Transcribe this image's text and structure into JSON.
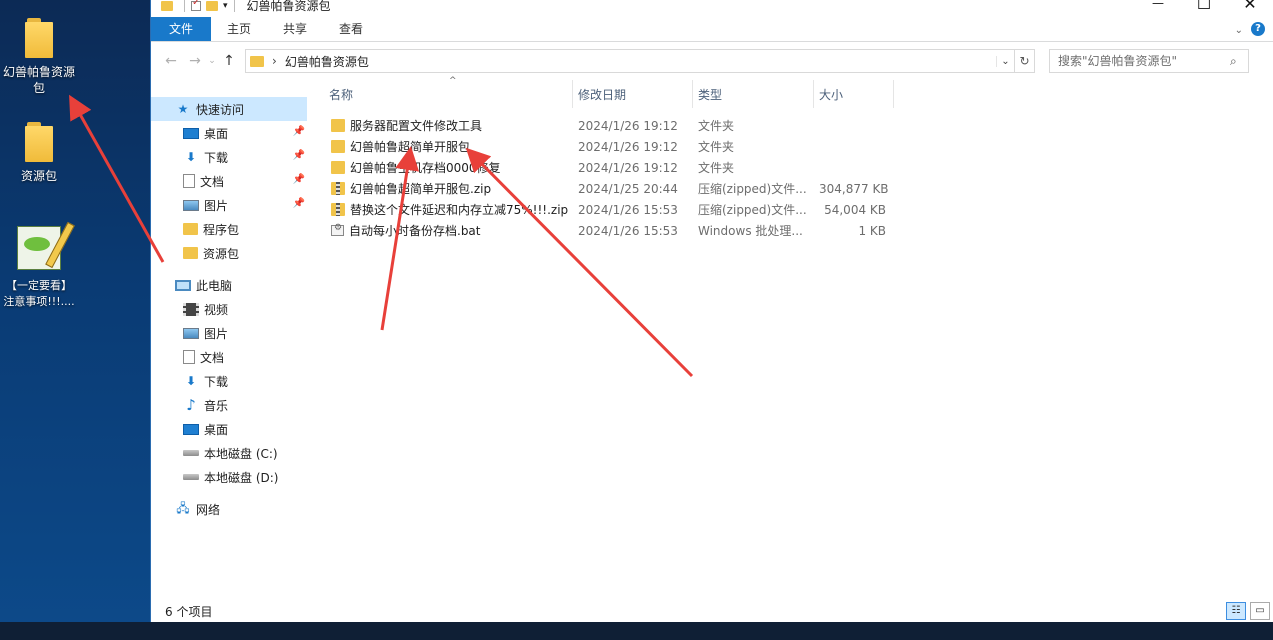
{
  "desktop": {
    "icons": [
      {
        "label": "幻兽帕鲁资源包",
        "type": "folder"
      },
      {
        "label": "资源包",
        "type": "folder"
      },
      {
        "label": "【一定要看】注意事项!!!....",
        "type": "notepad"
      }
    ]
  },
  "window": {
    "title": "幻兽帕鲁资源包",
    "controls": {
      "minimize": "—",
      "maximize": "☐",
      "close": "✕"
    }
  },
  "ribbon": {
    "tabs": [
      "文件",
      "主页",
      "共享",
      "查看"
    ]
  },
  "address": {
    "path": "幻兽帕鲁资源包",
    "search_placeholder": "搜索\"幻兽帕鲁资源包\""
  },
  "nav": {
    "quick_access": "快速访问",
    "items": [
      {
        "label": "桌面",
        "icon": "desktop-icon",
        "pinned": true
      },
      {
        "label": "下载",
        "icon": "download-icon",
        "pinned": true
      },
      {
        "label": "文档",
        "icon": "document-icon",
        "pinned": true
      },
      {
        "label": "图片",
        "icon": "picture-icon",
        "pinned": true
      },
      {
        "label": "程序包",
        "icon": "folder-icon",
        "pinned": false
      },
      {
        "label": "资源包",
        "icon": "folder-icon",
        "pinned": false
      }
    ],
    "this_pc": "此电脑",
    "pc_items": [
      {
        "label": "视频",
        "icon": "video-icon"
      },
      {
        "label": "图片",
        "icon": "picture-icon"
      },
      {
        "label": "文档",
        "icon": "document-icon"
      },
      {
        "label": "下载",
        "icon": "download-icon"
      },
      {
        "label": "音乐",
        "icon": "music-icon"
      },
      {
        "label": "桌面",
        "icon": "desktop-icon"
      },
      {
        "label": "本地磁盘 (C:)",
        "icon": "drive-icon"
      },
      {
        "label": "本地磁盘 (D:)",
        "icon": "drive-icon"
      }
    ],
    "network": "网络"
  },
  "files": {
    "columns": [
      "名称",
      "修改日期",
      "类型",
      "大小"
    ],
    "rows": [
      {
        "name": "服务器配置文件修改工具",
        "date": "2024/1/26 19:12",
        "type": "文件夹",
        "size": "",
        "icon": "folder"
      },
      {
        "name": "幻兽帕鲁超简单开服包",
        "date": "2024/1/26 19:12",
        "type": "文件夹",
        "size": "",
        "icon": "folder"
      },
      {
        "name": "幻兽帕鲁主机存档0000修复",
        "date": "2024/1/26 19:12",
        "type": "文件夹",
        "size": "",
        "icon": "folder"
      },
      {
        "name": "幻兽帕鲁超简单开服包.zip",
        "date": "2024/1/25 20:44",
        "type": "压缩(zipped)文件...",
        "size": "304,877 KB",
        "icon": "zip"
      },
      {
        "name": "替换这个文件延迟和内存立减75%!!!.zip",
        "date": "2024/1/26 15:53",
        "type": "压缩(zipped)文件...",
        "size": "54,004 KB",
        "icon": "zip"
      },
      {
        "name": "自动每小时备份存档.bat",
        "date": "2024/1/26 15:53",
        "type": "Windows 批处理...",
        "size": "1 KB",
        "icon": "bat"
      }
    ]
  },
  "status": {
    "count": "6 个项目"
  },
  "colors": {
    "accent": "#1979ca",
    "annotation_arrow": "#e8403a",
    "selection": "#cce8ff"
  }
}
